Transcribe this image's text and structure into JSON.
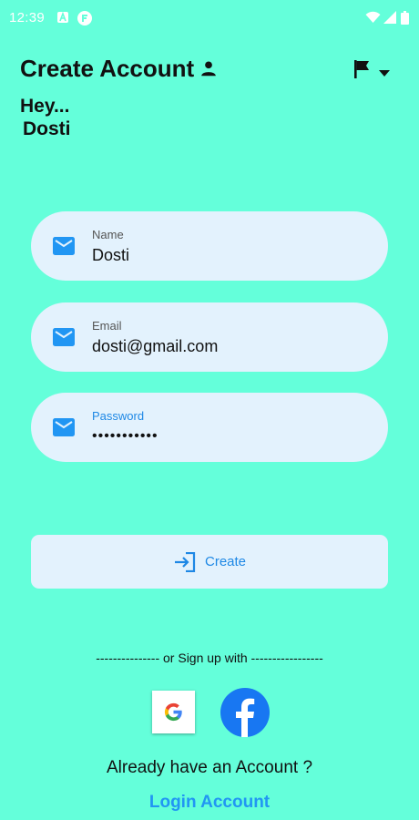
{
  "status_bar": {
    "time": "12:39",
    "icons": [
      "font-a-icon",
      "app-f-icon",
      "wifi-icon",
      "signal-icon",
      "battery-icon"
    ]
  },
  "header": {
    "title": "Create Account",
    "title_icon": "person-icon",
    "language_icon": "flag-icon"
  },
  "greeting": {
    "line1": "Hey...",
    "line2": "Dosti"
  },
  "form": {
    "name": {
      "label": "Name",
      "value": "Dosti",
      "icon": "mail-icon"
    },
    "email": {
      "label": "Email",
      "value": "dosti@gmail.com",
      "icon": "mail-icon"
    },
    "password": {
      "label": "Password",
      "value": "•••••••••••",
      "icon": "mail-icon"
    }
  },
  "create_button": {
    "label": "Create",
    "icon": "login-icon"
  },
  "social": {
    "divider_text": "--------------- or Sign up with -----------------",
    "google_icon": "google-icon",
    "facebook_icon": "facebook-icon"
  },
  "footer": {
    "prompt": "Already have an Account ?",
    "login_link": "Login Account"
  },
  "colors": {
    "background": "#64FFDA",
    "field_background": "#E3F2FD",
    "accent": "#1E88E5",
    "link": "#2196F3",
    "facebook": "#1877F2"
  }
}
